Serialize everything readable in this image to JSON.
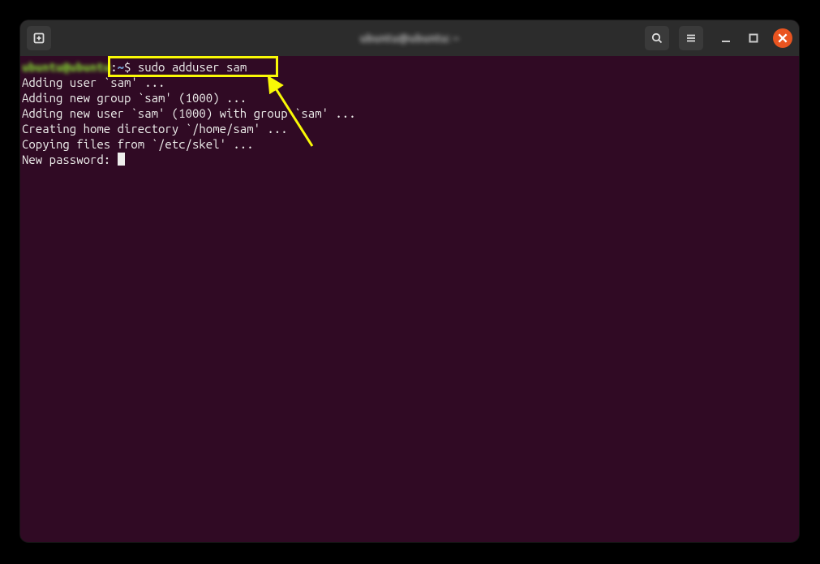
{
  "titlebar": {
    "title_blurred": "ubuntu@ubuntu: ~"
  },
  "terminal": {
    "prompt_user_blurred": "ubuntu@ubuntu",
    "prompt_sep": ":",
    "prompt_path": "~",
    "prompt_symbol": "$",
    "command": "sudo adduser sam",
    "lines": [
      "Adding user `sam' ...",
      "Adding new group `sam' (1000) ...",
      "Adding new user `sam' (1000) with group `sam' ...",
      "Creating home directory `/home/sam' ...",
      "Copying files from `/etc/skel' ...",
      "New password: "
    ]
  }
}
